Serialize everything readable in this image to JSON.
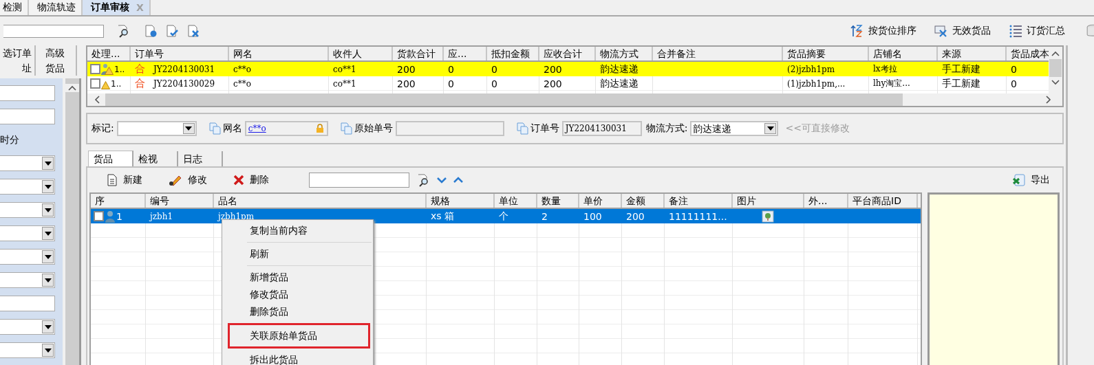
{
  "tabs": [
    {
      "label": "检测",
      "selected": false
    },
    {
      "label": "物流轨迹",
      "selected": false
    },
    {
      "label": "订单审核",
      "selected": true,
      "close": "X"
    }
  ],
  "toolbar": {
    "buttons": [
      {
        "label": "按货位排序"
      },
      {
        "label": "无效货品"
      },
      {
        "label": "订货汇总"
      }
    ]
  },
  "left_panel": {
    "tabs": [
      {
        "label": "选订单"
      },
      {
        "label": "高级"
      },
      {
        "label": "址"
      },
      {
        "label": "货品"
      }
    ],
    "fields": [
      {
        "kind": "input"
      },
      {
        "kind": "input"
      },
      {
        "kind": "label",
        "text": "时分"
      },
      {
        "kind": "select"
      },
      {
        "kind": "select"
      },
      {
        "kind": "select"
      },
      {
        "kind": "select"
      },
      {
        "kind": "select"
      },
      {
        "kind": "select"
      },
      {
        "kind": "input"
      },
      {
        "kind": "select"
      },
      {
        "kind": "select"
      }
    ]
  },
  "orders": {
    "columns": [
      "处理...",
      "订单号",
      "网名",
      "收件人",
      "货款合计",
      "应...",
      "抵扣金额",
      "应收合计",
      "物流方式",
      "合并备注",
      "货品摘要",
      "店铺名",
      "来源",
      "货品成本"
    ],
    "rows": [
      {
        "selected": true,
        "checked": false,
        "assigned": true,
        "warning": true,
        "flag": "合",
        "cells": [
          "1..",
          "JY2204130031",
          "c**o",
          "co**1",
          "200",
          "0",
          "0",
          "200",
          "韵达速递",
          null,
          "(2)jzbh1pm",
          "lx考拉",
          "手工新建",
          "0"
        ]
      },
      {
        "selected": false,
        "checked": false,
        "assigned": false,
        "warning": true,
        "flag": "合",
        "cells": [
          "1..",
          "JY2204130029",
          "c**o",
          "co**1",
          "200",
          "0",
          "0",
          "200",
          "韵达速递",
          null,
          "(1)jzbh1pm,...",
          "lhy淘宝...",
          "手工新建",
          "0"
        ]
      }
    ]
  },
  "order_form": {
    "mark_label": "标记:",
    "nick_label": "网名",
    "nick": "c**o",
    "original_no_label": "原始单号",
    "order_no_label": "订单号",
    "order_no": "JY2204130031",
    "logistics_label": "物流方式:",
    "logistics": "韵达速递",
    "hint": "<<可直接修改"
  },
  "detail_tabs": [
    {
      "label": "货品",
      "selected": true
    },
    {
      "label": "检视",
      "selected": false
    },
    {
      "label": "日志",
      "selected": false
    }
  ],
  "goods_toolbar": {
    "buttons": [
      {
        "label": "新建"
      },
      {
        "label": "修改"
      },
      {
        "label": "删除"
      }
    ],
    "export": "导出"
  },
  "goods": {
    "columns": [
      "序",
      "编号",
      "品名",
      "规格",
      "单位",
      "数量",
      "单价",
      "金额",
      "备注",
      "图片",
      "外...",
      "平台商品ID"
    ],
    "rows": [
      {
        "selected": true,
        "checked": false,
        "cells": [
          "1",
          "jzbh1",
          "jzbh1pm",
          "xs 箱",
          "个",
          "2",
          "100",
          "200",
          "11111111...",
          {
            "kind": "image"
          },
          null,
          null
        ]
      }
    ]
  },
  "context_menu": {
    "items": [
      {
        "kind": "item",
        "label": "复制当前内容",
        "highlighted": false
      },
      {
        "kind": "separator"
      },
      {
        "kind": "item",
        "label": "刷新",
        "highlighted": false
      },
      {
        "kind": "separator"
      },
      {
        "kind": "item",
        "label": "新增货品",
        "highlighted": false
      },
      {
        "kind": "item",
        "label": "修改货品",
        "highlighted": false
      },
      {
        "kind": "item",
        "label": "删除货品",
        "highlighted": false
      },
      {
        "kind": "item",
        "label": "关联原始单货品",
        "highlighted": true
      },
      {
        "kind": "item",
        "label": "拆出此货品",
        "highlighted": false
      }
    ]
  }
}
